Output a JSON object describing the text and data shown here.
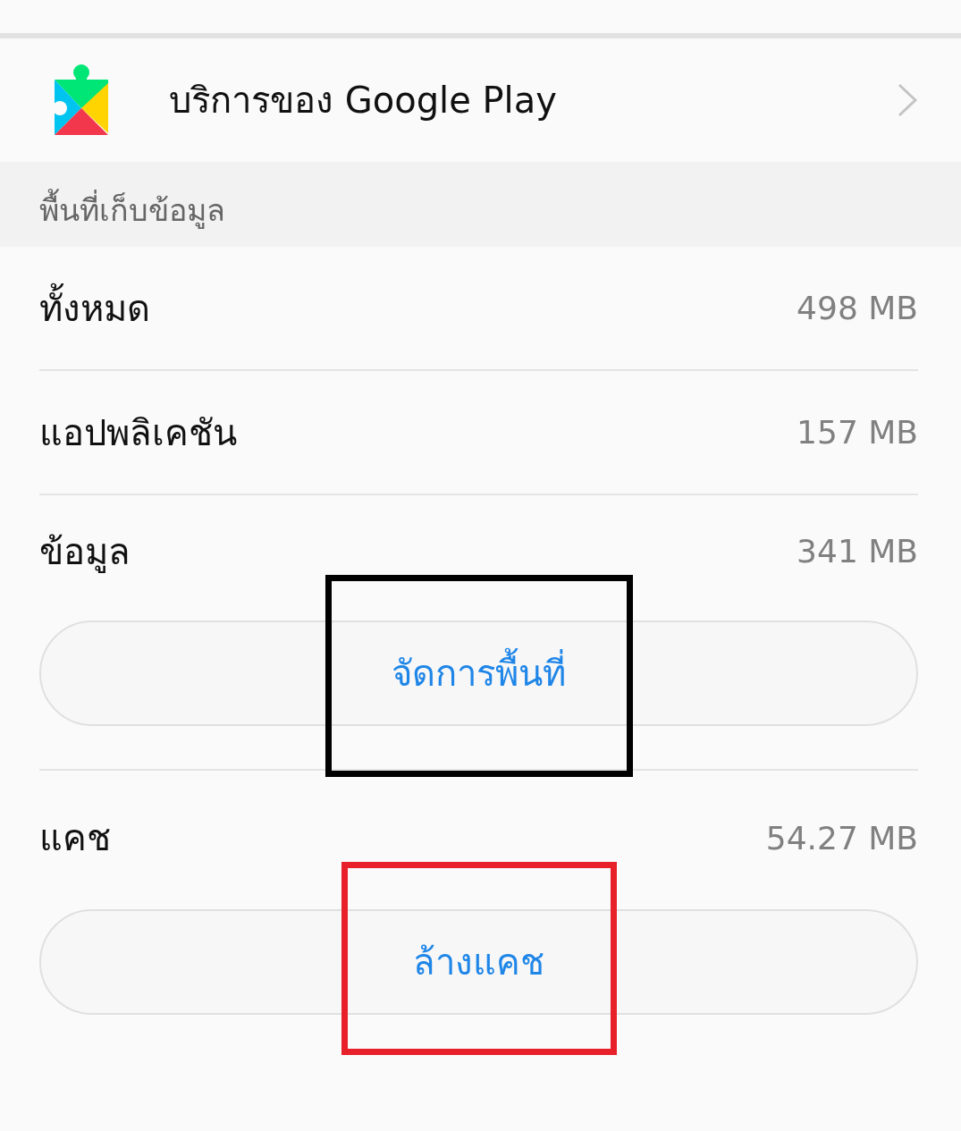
{
  "app": {
    "name": "บริการของ Google Play"
  },
  "section": {
    "title": "พื้นที่เก็บข้อมูล"
  },
  "items": [
    {
      "kind": "stat",
      "label": "ทั้งหมด",
      "value": "498 MB"
    },
    {
      "kind": "stat",
      "label": "แอปพลิเคชัน",
      "value": "157 MB"
    },
    {
      "kind": "stat",
      "label": "ข้อมูล",
      "value": "341 MB"
    },
    {
      "kind": "action",
      "label": "จัดการพื้นที่",
      "highlight": {
        "color": "#000000"
      }
    },
    {
      "kind": "stat",
      "label": "แคช",
      "value": "54.27 MB"
    },
    {
      "kind": "action",
      "label": "ล้างแคช",
      "highlight": {
        "color": "#e8202a"
      }
    }
  ]
}
